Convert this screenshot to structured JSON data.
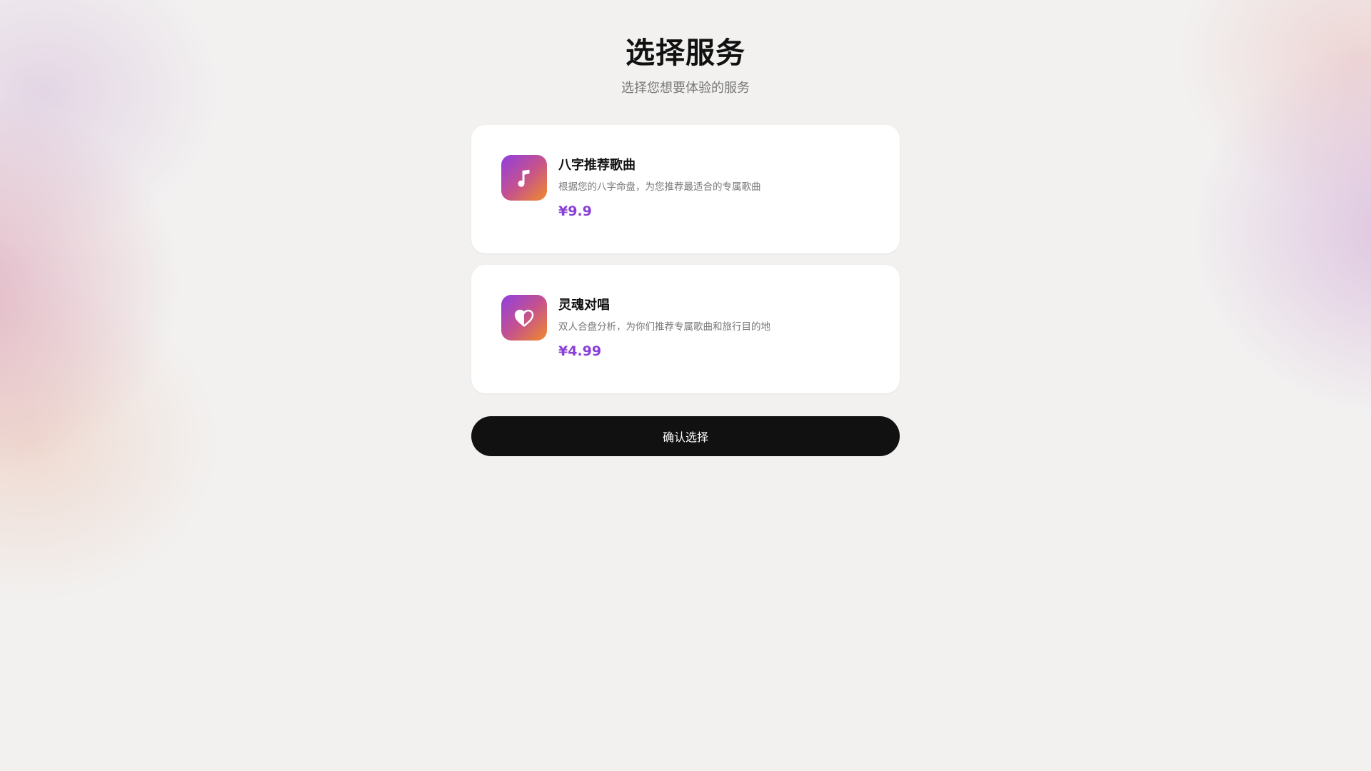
{
  "header": {
    "title": "选择服务",
    "subtitle": "选择您想要体验的服务"
  },
  "services": [
    {
      "icon": "music-note-icon",
      "title": "八字推荐歌曲",
      "description": "根据您的八字命盘，为您推荐最适合的专属歌曲",
      "price": "¥9.9"
    },
    {
      "icon": "heart-icon",
      "title": "灵魂对唱",
      "description": "双人合盘分析，为你们推荐专属歌曲和旅行目的地",
      "price": "¥4.99"
    }
  ],
  "actions": {
    "confirm_label": "确认选择"
  },
  "colors": {
    "accent_price": "#8a3fd6",
    "icon_gradient_start": "#8f3fe0",
    "icon_gradient_end": "#f08a2a",
    "button_bg": "#111111"
  }
}
